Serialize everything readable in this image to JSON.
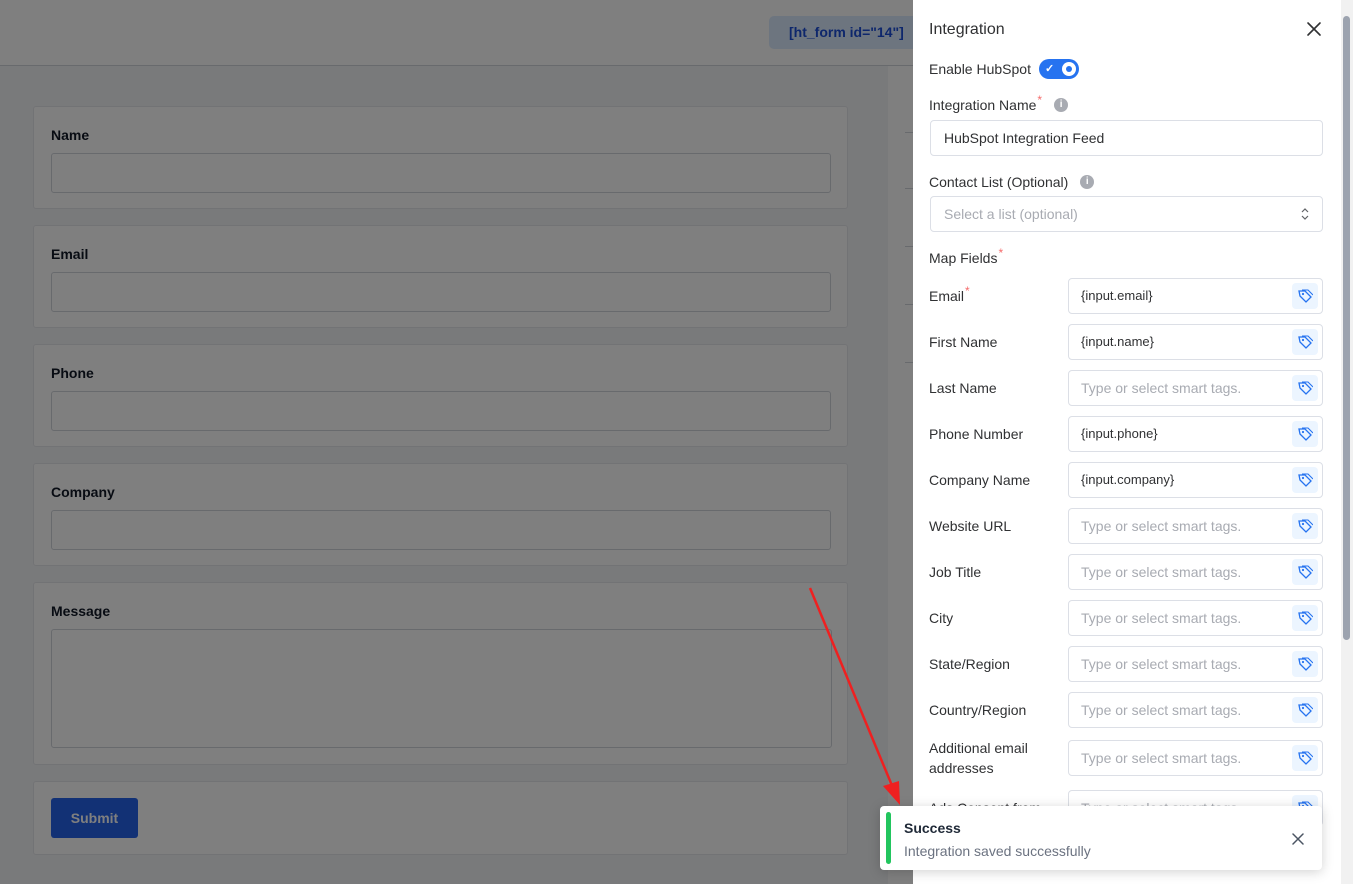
{
  "background": {
    "shortcode": "[ht_form id=\"14\"]",
    "fields": [
      {
        "label": "Name"
      },
      {
        "label": "Email"
      },
      {
        "label": "Phone"
      },
      {
        "label": "Company"
      },
      {
        "label": "Message"
      }
    ],
    "submit_label": "Submit"
  },
  "drawer": {
    "title": "Integration",
    "enable_label": "Enable HubSpot",
    "enabled": true,
    "integration_name_label": "Integration Name",
    "integration_name_value": "HubSpot Integration Feed",
    "contact_list_label": "Contact List (Optional)",
    "contact_list_placeholder": "Select a list (optional)",
    "map_fields_label": "Map Fields",
    "map_fields": [
      {
        "label": "Email",
        "value": "{input.email}",
        "placeholder": "",
        "required": "*"
      },
      {
        "label": "First Name",
        "value": "{input.name}",
        "placeholder": ""
      },
      {
        "label": "Last Name",
        "value": "",
        "placeholder": "Type or select smart tags."
      },
      {
        "label": "Phone Number",
        "value": "{input.phone}",
        "placeholder": ""
      },
      {
        "label": "Company Name",
        "value": "{input.company}",
        "placeholder": ""
      },
      {
        "label": "Website URL",
        "value": "",
        "placeholder": "Type or select smart tags."
      },
      {
        "label": "Job Title",
        "value": "",
        "placeholder": "Type or select smart tags."
      },
      {
        "label": "City",
        "value": "",
        "placeholder": "Type or select smart tags."
      },
      {
        "label": "State/Region",
        "value": "",
        "placeholder": "Type or select smart tags."
      },
      {
        "label": "Country/Region",
        "value": "",
        "placeholder": "Type or select smart tags."
      },
      {
        "label": "Additional email addresses",
        "value": "",
        "placeholder": "Type or select smart tags."
      },
      {
        "label": "Ads Consent from",
        "value": "",
        "placeholder": "Type or select smart tags."
      }
    ]
  },
  "toast": {
    "title": "Success",
    "message": "Integration saved successfully",
    "color": "#22c55e"
  }
}
